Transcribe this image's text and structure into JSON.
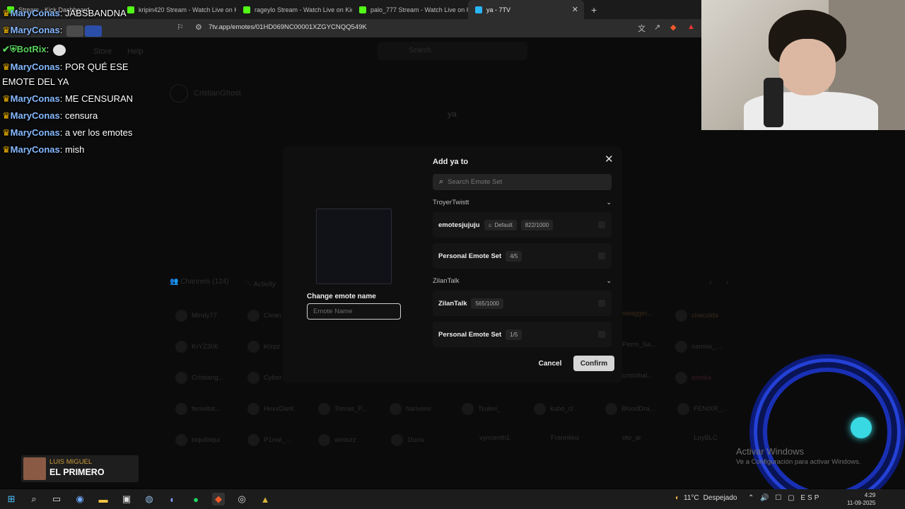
{
  "browser": {
    "tabs": [
      {
        "label": "Stream - Kick Dashboard",
        "active": false
      },
      {
        "label": "kripin420 Stream - Watch Live on Kick",
        "active": false
      },
      {
        "label": "rageylo Stream - Watch Live on Kick",
        "active": false
      },
      {
        "label": "palo_777 Stream - Watch Live on Kick",
        "active": false
      },
      {
        "label": "ya - 7TV",
        "active": true
      }
    ],
    "url": "7tv.app/emotes/01HD069NC00001XZGYCNQQ549K"
  },
  "site": {
    "nav": {
      "store": "Store",
      "help": "Help"
    },
    "search_placeholder": "Search",
    "owner": "CristianGhost",
    "emote_title": "ya",
    "channels_tab": "Channels (124)",
    "activity_tab": "Activity",
    "channels": [
      "Mindy77",
      "Clean",
      "swaggin...",
      "chacolda",
      "KrYZ306",
      "k0rpz",
      "Perro_Sa...",
      "namiiix_...",
      "Cristiang...",
      "Cyber",
      "cristobal...",
      "elreika",
      "fenixitot...",
      "HexxDarK",
      "Tomas_P...",
      "harivens",
      "Tsukei_",
      "kubo_cl",
      "BloodDra...",
      "FENIXR_...",
      "biquibiqui",
      "P1nwi_...",
      "winiszz",
      "1luciv",
      "vyncenth1",
      "Frannkku",
      "oto_ar",
      "LuyBLC"
    ]
  },
  "chat": {
    "lines": [
      {
        "user": "MaryConas",
        "text": "JABSBANDNA"
      },
      {
        "user": "MaryConas",
        "text": ""
      },
      {
        "user": "BotRix",
        "text": ""
      },
      {
        "user": "MaryConas",
        "text": "POR QUÉ ESE"
      },
      {
        "user": "",
        "text": "EMOTE DEL YA"
      },
      {
        "user": "MaryConas",
        "text": "ME CENSURAN"
      },
      {
        "user": "MaryConas",
        "text": "censura"
      },
      {
        "user": "MaryConas",
        "text": "a ver los emotes"
      },
      {
        "user": "MaryConas",
        "text": "mish"
      }
    ]
  },
  "modal": {
    "title": "Add ya to",
    "search_placeholder": "Search Emote Set",
    "rename_label": "Change emote name",
    "rename_placeholder": "Emote Name",
    "groups": [
      {
        "name": "TroyerTwistt",
        "sets": [
          {
            "name": "emotesjujuju",
            "badge_default": "Default",
            "count": "822/1000"
          },
          {
            "name": "Personal Emote Set",
            "count": "4/5"
          }
        ]
      },
      {
        "name": "ZilanTalk",
        "sets": [
          {
            "name": "ZilanTalk",
            "count": "565/1000"
          },
          {
            "name": "Personal Emote Set",
            "count": "1/5"
          }
        ]
      }
    ],
    "cancel": "Cancel",
    "confirm": "Confirm"
  },
  "overlay": {
    "alert_sub": "LUIS MIGUEL",
    "alert_main": "EL PRIMERO",
    "activate_title": "Activar Windows",
    "activate_sub": "Ve a Configuración para activar Windows."
  },
  "taskbar": {
    "weather": "11°C",
    "weather_desc": "Despejado",
    "lang": "ESP",
    "time": "4:29",
    "date": "11-09-2025"
  },
  "colors": {
    "accent": "#2441d6",
    "chat_name": "#86b9ff",
    "crown": "#f1b400",
    "bot_name": "#59d35b"
  }
}
